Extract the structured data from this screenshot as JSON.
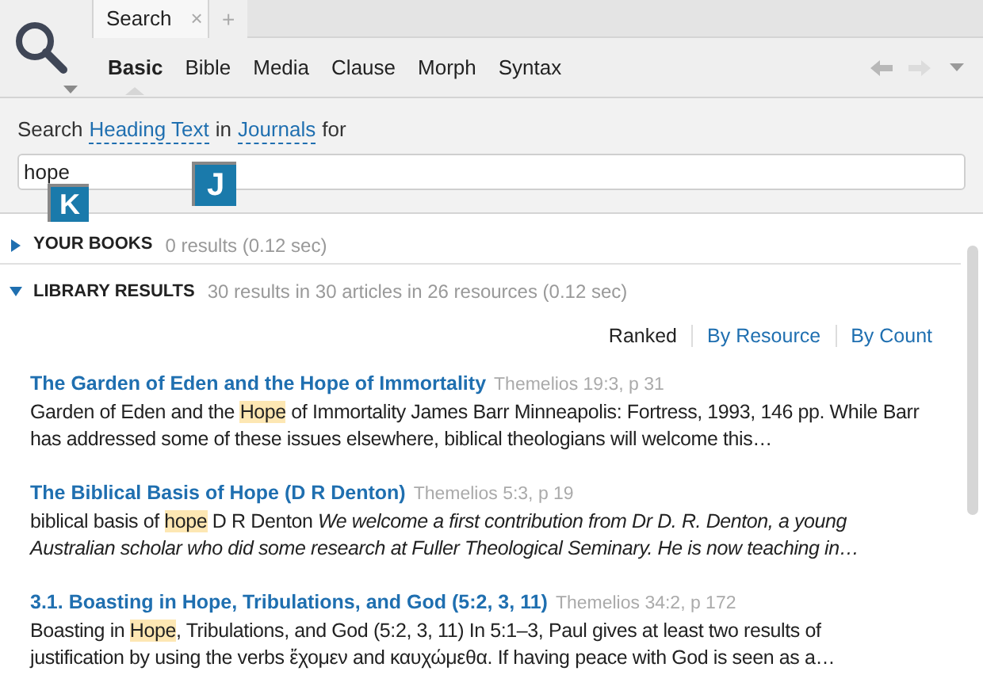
{
  "tab": {
    "title": "Search",
    "close": "×",
    "add": "+"
  },
  "search_types": [
    {
      "label": "Basic",
      "selected": true
    },
    {
      "label": "Bible",
      "selected": false
    },
    {
      "label": "Media",
      "selected": false
    },
    {
      "label": "Clause",
      "selected": false
    },
    {
      "label": "Morph",
      "selected": false
    },
    {
      "label": "Syntax",
      "selected": false
    }
  ],
  "query_line": [
    {
      "kind": "text",
      "text": "Search"
    },
    {
      "kind": "link",
      "text": "Heading Text"
    },
    {
      "kind": "text",
      "text": "in"
    },
    {
      "kind": "link",
      "text": "Journals"
    },
    {
      "kind": "text",
      "text": "for"
    }
  ],
  "search": {
    "value": "hope"
  },
  "keytips": [
    {
      "key": "K"
    },
    {
      "key": "J"
    }
  ],
  "sections": [
    {
      "title": "YOUR BOOKS",
      "summary": "0 results (0.12 sec)",
      "expanded": false
    },
    {
      "title": "LIBRARY RESULTS",
      "summary": "30 results in 30 articles in 26 resources (0.12 sec)",
      "expanded": true
    }
  ],
  "sort_options": [
    {
      "label": "Ranked",
      "selected": true
    },
    {
      "label": "By Resource",
      "selected": false
    },
    {
      "label": "By Count",
      "selected": false
    }
  ],
  "results": [
    {
      "title": "The Garden of Eden and the Hope of Immortality",
      "source": "Themelios 19:3, p 31",
      "snippet": [
        {
          "kind": "plain",
          "text": "Garden of Eden and the "
        },
        {
          "kind": "hit",
          "text": "Hope"
        },
        {
          "kind": "plain",
          "text": " of Immortality James Barr Minneapolis: Fortress, 1993, 146 pp. While Barr has addressed some of these issues elsewhere, biblical theologians will welcome this…"
        }
      ]
    },
    {
      "title": "The Biblical Basis of Hope (D R Denton)",
      "source": "Themelios 5:3, p 19",
      "snippet": [
        {
          "kind": "plain",
          "text": "biblical basis of "
        },
        {
          "kind": "hit",
          "text": "hope"
        },
        {
          "kind": "plain",
          "text": " D R Denton "
        },
        {
          "kind": "italic",
          "text": "We welcome a first contribution from Dr D. R. Denton, a young Australian scholar who did some research at Fuller Theological Seminary. He is now teaching in…"
        }
      ]
    },
    {
      "title": "3.1. Boasting in Hope, Tribulations, and God (5:2, 3, 11)",
      "source": "Themelios 34:2, p 172",
      "snippet": [
        {
          "kind": "plain",
          "text": "Boasting in "
        },
        {
          "kind": "hit",
          "text": "Hope"
        },
        {
          "kind": "plain",
          "text": ", Tribulations, and God (5:2, 3, 11) In 5:1–3, Paul gives at least two results of justification by using the verbs ἔχομεν and καυχώμεθα. If having peace with God is seen as a…"
        }
      ]
    }
  ]
}
